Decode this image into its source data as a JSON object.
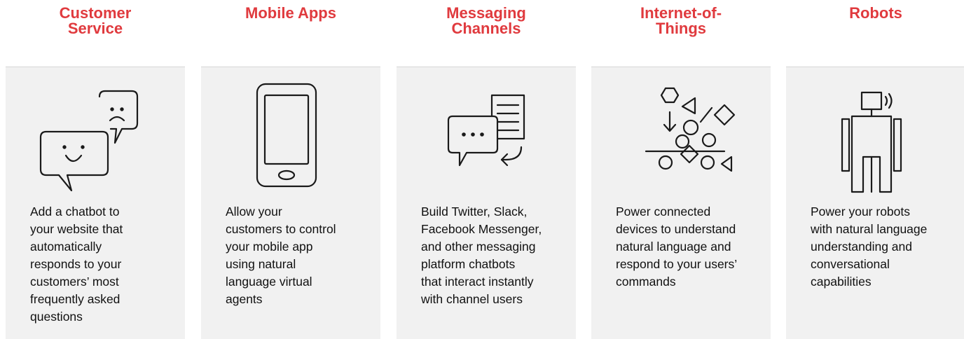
{
  "columns": [
    {
      "id": "customer-service",
      "title_lines": [
        "Customer",
        "Service"
      ],
      "icon": "chat-bubbles-icon",
      "desc_lines": [
        "Add a chatbot to",
        "your website that",
        "automatically",
        "responds to your",
        "customers’ most",
        "frequently asked",
        "questions"
      ]
    },
    {
      "id": "mobile-apps",
      "title_lines": [
        "Mobile Apps"
      ],
      "icon": "smartphone-icon",
      "desc_lines": [
        "Allow your",
        "customers to control",
        "your mobile app",
        "using natural",
        "language virtual",
        "agents"
      ]
    },
    {
      "id": "messaging-channels",
      "title_lines": [
        "Messaging",
        "Channels"
      ],
      "icon": "message-document-icon",
      "desc_lines": [
        "Build Twitter, Slack,",
        "Facebook Messenger,",
        "and other messaging",
        "platform chatbots",
        "that interact instantly",
        "with channel users"
      ]
    },
    {
      "id": "internet-of-things",
      "title_lines": [
        "Internet-of-",
        "Things"
      ],
      "icon": "iot-shapes-icon",
      "desc_lines": [
        "Power connected",
        "devices to understand",
        "natural language and",
        "respond to your users’",
        "commands"
      ]
    },
    {
      "id": "robots",
      "title_lines": [
        "Robots"
      ],
      "icon": "robot-icon",
      "desc_lines": [
        "Power your robots",
        "with natural language",
        "understanding and",
        "conversational",
        "capabilities"
      ]
    }
  ],
  "colors": {
    "title": "#e03a3e",
    "card": "#f1f1f1",
    "text": "#111111",
    "icon_stroke": "#1a1a1a"
  }
}
